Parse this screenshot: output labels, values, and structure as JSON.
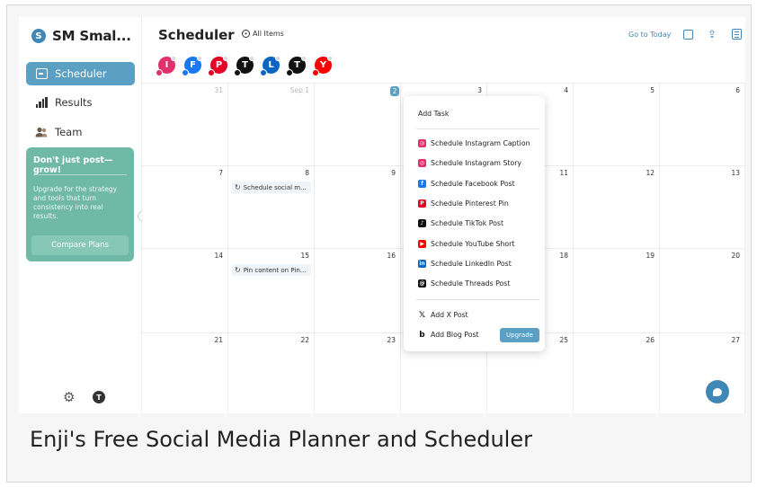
{
  "brand": {
    "logo_letter": "S",
    "name": "SM Smal..."
  },
  "sidebar": {
    "items": [
      {
        "label": "Scheduler",
        "icon": "calendar-icon",
        "active": true
      },
      {
        "label": "Results",
        "icon": "bar-chart-icon",
        "active": false
      },
      {
        "label": "Team",
        "icon": "team-icon",
        "active": false
      }
    ],
    "promo": {
      "title": "Don't just post—grow!",
      "text": "Upgrade for the strategy and tools that turn consistency into real results.",
      "button": "Compare Plans"
    },
    "footer": {
      "settings_icon": "gear-icon",
      "avatar_letter": "T"
    }
  },
  "header": {
    "title": "Scheduler",
    "filter_label": "All Items",
    "goto_today": "Go to Today",
    "icons": [
      "image-icon",
      "share-icon",
      "list-view-icon"
    ]
  },
  "accounts": [
    {
      "letter": "I",
      "color": "#e1306c",
      "network": "instagram",
      "net_color": "#e1306c"
    },
    {
      "letter": "F",
      "color": "#1877f2",
      "network": "facebook",
      "net_color": "#1877f2"
    },
    {
      "letter": "P",
      "color": "#e60023",
      "network": "pinterest",
      "net_color": "#e60023"
    },
    {
      "letter": "T",
      "color": "#111111",
      "network": "tiktok",
      "net_color": "#111111"
    },
    {
      "letter": "L",
      "color": "#0a66c2",
      "network": "linkedin",
      "net_color": "#0a66c2"
    },
    {
      "letter": "T",
      "color": "#111111",
      "network": "threads",
      "net_color": "#111111"
    },
    {
      "letter": "Y",
      "color": "#ff0000",
      "network": "youtube",
      "net_color": "#ff0000"
    }
  ],
  "calendar": {
    "weeks": [
      [
        {
          "day": "31",
          "muted": true
        },
        {
          "day": "Sep 1",
          "muted": true
        },
        {
          "day": "2",
          "today": true
        },
        {
          "day": "3"
        },
        {
          "day": "4"
        },
        {
          "day": "5"
        },
        {
          "day": "6"
        }
      ],
      [
        {
          "day": "7"
        },
        {
          "day": "8",
          "event": "Schedule social m..."
        },
        {
          "day": "9"
        },
        {
          "day": "10"
        },
        {
          "day": "11"
        },
        {
          "day": "12"
        },
        {
          "day": "13"
        }
      ],
      [
        {
          "day": "14"
        },
        {
          "day": "15",
          "event": "Pin content on Pin..."
        },
        {
          "day": "16"
        },
        {
          "day": "17"
        },
        {
          "day": "18"
        },
        {
          "day": "19"
        },
        {
          "day": "20"
        }
      ],
      [
        {
          "day": "21"
        },
        {
          "day": "22"
        },
        {
          "day": "23"
        },
        {
          "day": "24"
        },
        {
          "day": "25"
        },
        {
          "day": "26"
        },
        {
          "day": "27"
        }
      ]
    ],
    "add_button": "+"
  },
  "menu": {
    "add_task": "Add Task",
    "items": [
      {
        "label": "Schedule Instagram Caption",
        "icon": "instagram-icon",
        "color": "#e1306c"
      },
      {
        "label": "Schedule Instagram Story",
        "icon": "instagram-icon",
        "color": "#e1306c"
      },
      {
        "label": "Schedule Facebook Post",
        "icon": "facebook-icon",
        "color": "#1877f2"
      },
      {
        "label": "Schedule Pinterest Pin",
        "icon": "pinterest-icon",
        "color": "#e60023"
      },
      {
        "label": "Schedule TikTok Post",
        "icon": "tiktok-icon",
        "color": "#111111"
      },
      {
        "label": "Schedule YouTube Short",
        "icon": "youtube-shorts-icon",
        "color": "#ff0000"
      },
      {
        "label": "Schedule LinkedIn Post",
        "icon": "linkedin-icon",
        "color": "#0a66c2"
      },
      {
        "label": "Schedule Threads Post",
        "icon": "threads-icon",
        "color": "#111111"
      }
    ],
    "extra": [
      {
        "label": "Add X Post",
        "icon": "x-icon"
      },
      {
        "label": "Add Blog Post",
        "icon": "blog-icon"
      }
    ],
    "upgrade": "Upgrade"
  },
  "caption": "Enji's Free Social Media Planner and Scheduler"
}
